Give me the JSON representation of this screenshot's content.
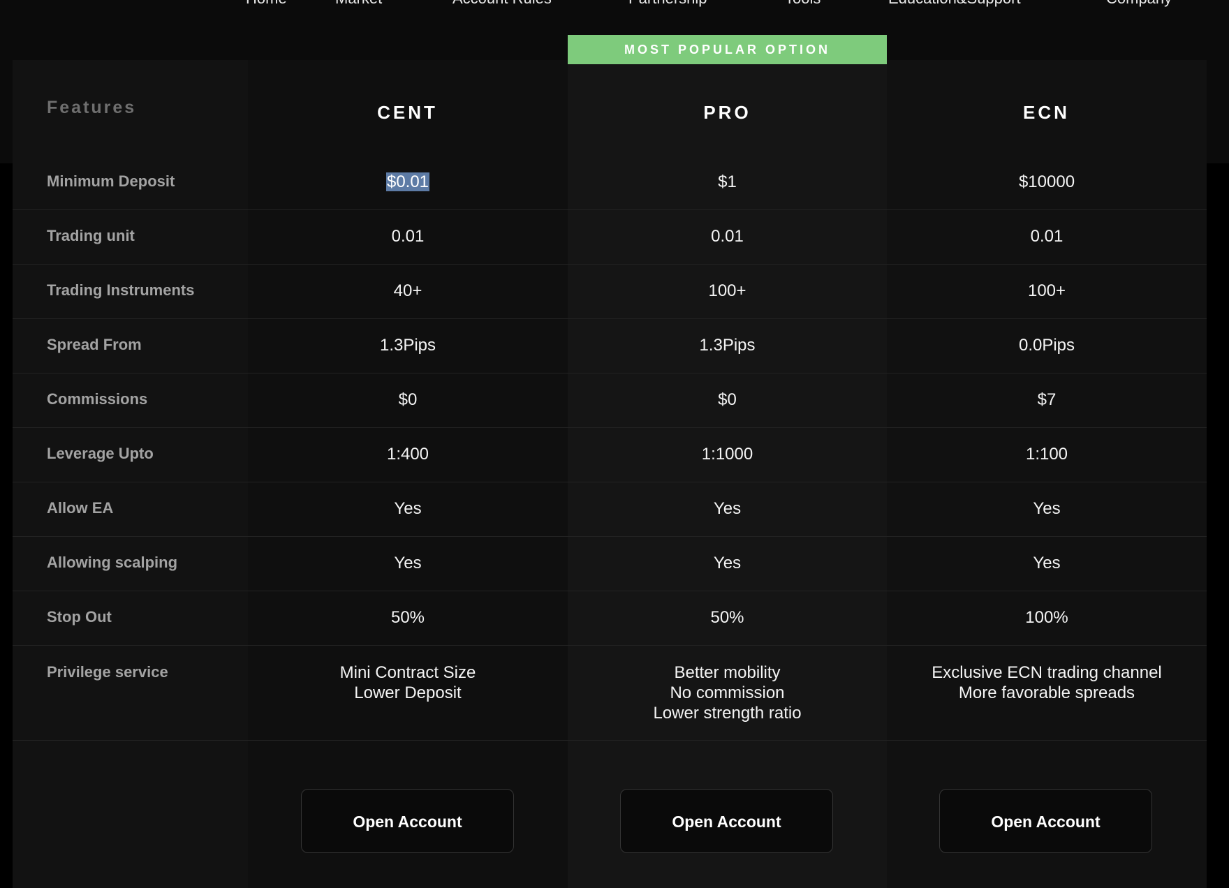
{
  "nav": {
    "items": [
      "Home",
      "Market",
      "Account Rules",
      "Partnership",
      "Tools",
      "Education&Support",
      "Company"
    ]
  },
  "banner": {
    "label": "MOST POPULAR OPTION"
  },
  "table": {
    "features_heading": "Features",
    "plans": [
      "CENT",
      "PRO",
      "ECN"
    ],
    "rows": [
      {
        "label": "Minimum Deposit",
        "values": [
          "$0.01",
          "$1",
          "$10000"
        ]
      },
      {
        "label": "Trading unit",
        "values": [
          "0.01",
          "0.01",
          "0.01"
        ]
      },
      {
        "label": "Trading Instruments",
        "values": [
          "40+",
          "100+",
          "100+"
        ]
      },
      {
        "label": "Spread From",
        "values": [
          "1.3Pips",
          "1.3Pips",
          "0.0Pips"
        ]
      },
      {
        "label": "Commissions",
        "values": [
          "$0",
          "$0",
          "$7"
        ]
      },
      {
        "label": "Leverage Upto",
        "values": [
          "1:400",
          "1:1000",
          "1:100"
        ]
      },
      {
        "label": "Allow EA",
        "values": [
          "Yes",
          "Yes",
          "Yes"
        ]
      },
      {
        "label": "Allowing scalping",
        "values": [
          "Yes",
          "Yes",
          "Yes"
        ]
      },
      {
        "label": "Stop Out",
        "values": [
          "50%",
          "50%",
          "100%"
        ]
      }
    ],
    "privilege": {
      "label": "Privilege service",
      "values": [
        [
          "Mini Contract Size",
          "Lower Deposit"
        ],
        [
          "Better mobility",
          "No commission",
          "Lower strength ratio"
        ],
        [
          "Exclusive ECN trading channel",
          "More favorable spreads"
        ]
      ]
    },
    "open_account_label": "Open Account"
  },
  "colors": {
    "background": "#000000",
    "banner": "#7ecb7c",
    "selection": "#5d7ba5"
  }
}
